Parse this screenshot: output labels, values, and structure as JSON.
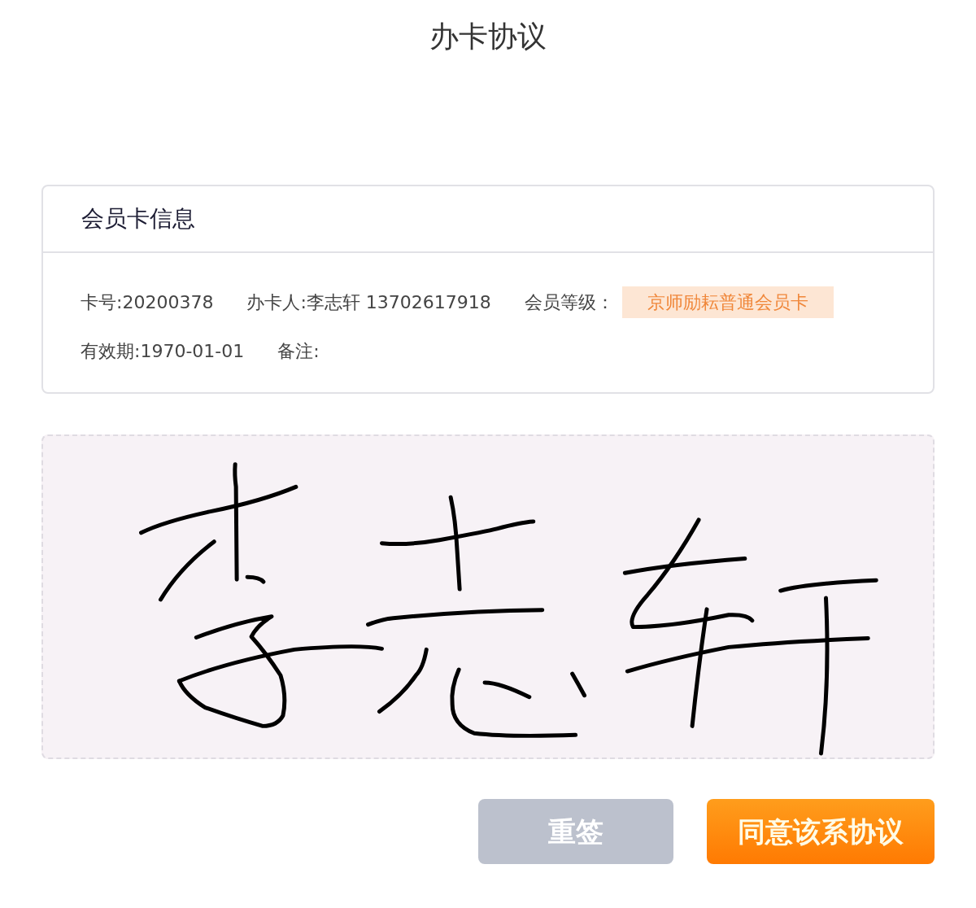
{
  "page": {
    "title": "办卡协议"
  },
  "card": {
    "title": "会员卡信息",
    "rows": [
      [
        {
          "kind": "plain",
          "text": "卡号:20200378"
        },
        {
          "kind": "plain",
          "text": "办卡人:李志轩 13702617918"
        },
        {
          "kind": "tagged",
          "label": "会员等级：",
          "tag": "京师励耘普通会员卡"
        }
      ],
      [
        {
          "kind": "plain",
          "text": "有效期:1970-01-01"
        },
        {
          "kind": "plain",
          "text": "备注:"
        }
      ]
    ]
  },
  "signature_pad": {
    "signed": true
  },
  "buttons": [
    {
      "kind": "secondary",
      "label": "重签"
    },
    {
      "kind": "primary",
      "label": "同意该系协议"
    }
  ]
}
